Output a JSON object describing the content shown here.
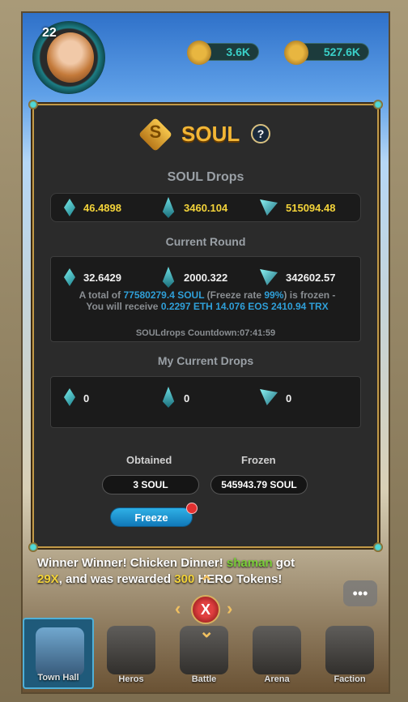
{
  "hud": {
    "level": "22",
    "gold": "3.6K",
    "tokens": "527.6K"
  },
  "modal": {
    "title": "SOUL",
    "logo_letter": "S",
    "help_label": "?",
    "drops_title": "SOUL Drops",
    "drops": {
      "eos": "46.4898",
      "eth": "3460.104",
      "trx": "515094.48"
    },
    "current_round_title": "Current Round",
    "current_round": {
      "eos": "32.6429",
      "eth": "2000.322",
      "trx": "342602.57",
      "note_prefix": "A total of ",
      "total_soul": "77580279.4 SOUL",
      "note_mid1": " (Freeze rate ",
      "freeze_rate": "99%",
      "note_mid2": ") is frozen - You will receive ",
      "receive_eth": "0.2297 ETH",
      "receive_eos": "14.076 EOS",
      "receive_trx": "2410.94 TRX",
      "countdown": "SOULdrops Countdown:07:41:59"
    },
    "my_drops_title": "My Current Drops",
    "my_drops": {
      "eos": "0",
      "eth": "0",
      "trx": "0"
    },
    "obtained_label": "Obtained",
    "obtained_value": "3 SOUL",
    "frozen_label": "Frozen",
    "frozen_value": "545943.79 SOUL",
    "freeze_button": "Freeze"
  },
  "ticker": {
    "part1": "Winner Winner! Chicken Dinner! ",
    "user": "shaman",
    "part2": " got ",
    "mult": "29X",
    "part3": ", and was rewarded ",
    "amount": "300",
    "part4": " HERO Tokens!"
  },
  "close_label": "X",
  "nav": [
    "Town Hall",
    "Heros",
    "Battle",
    "Arena",
    "Faction"
  ],
  "colors": {
    "accent": "#f2b636",
    "highlight": "#2f9fd8",
    "button": "#1a94d0"
  }
}
